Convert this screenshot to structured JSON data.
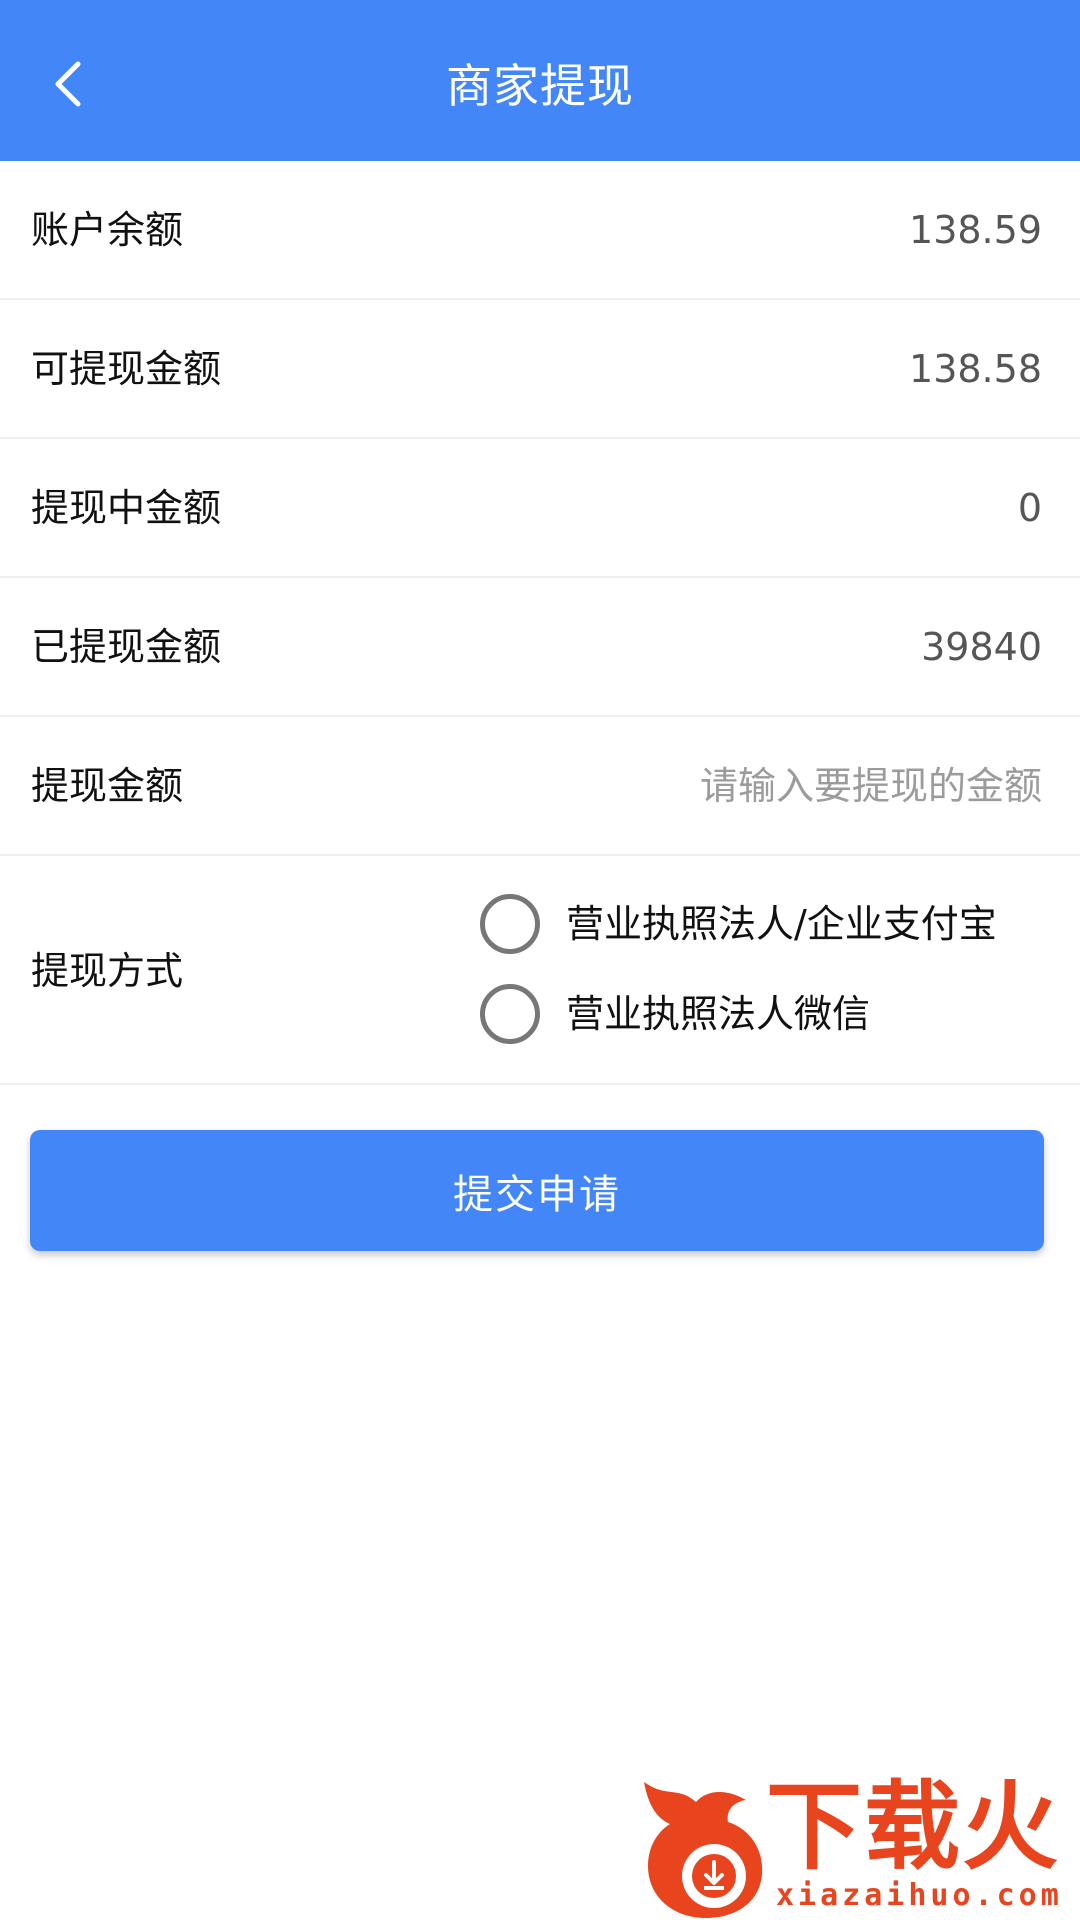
{
  "header": {
    "title": "商家提现",
    "back_icon": "chevron-left-icon"
  },
  "rows": {
    "account_balance": {
      "label": "账户余额",
      "value": "138.59"
    },
    "withdrawable": {
      "label": "可提现金额",
      "value": "138.58"
    },
    "withdrawing": {
      "label": "提现中金额",
      "value": "0"
    },
    "withdrawn": {
      "label": "已提现金额",
      "value": "39840"
    },
    "amount": {
      "label": "提现金额",
      "value": "",
      "placeholder": "请输入要提现的金额"
    },
    "method": {
      "label": "提现方式",
      "options": [
        {
          "label": "营业执照法人/企业支付宝",
          "selected": false
        },
        {
          "label": "营业执照法人微信",
          "selected": false
        }
      ]
    }
  },
  "submit": {
    "label": "提交申请"
  },
  "watermark": {
    "brand": "下载火",
    "url": "xiazaihuo.com"
  },
  "colors": {
    "primary": "#4386f7",
    "watermark": "#e8441e",
    "divider": "#efefef"
  }
}
